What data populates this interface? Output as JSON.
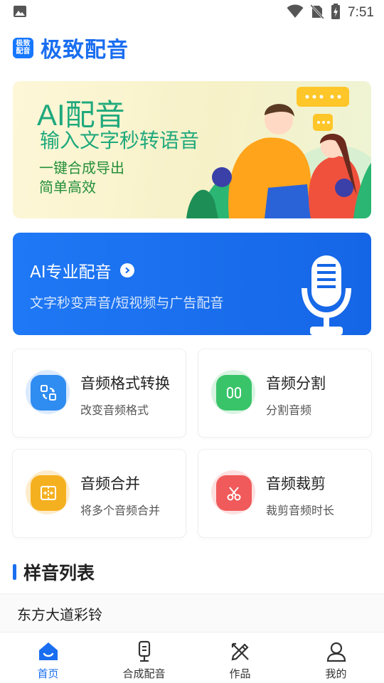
{
  "status_bar": {
    "time": "7:51"
  },
  "header": {
    "logo_text": "极致\n配音",
    "title": "极致配音"
  },
  "banner": {
    "title": "AI配音",
    "subtitle": "输入文字秒转语音",
    "line1": "一键合成导出",
    "line2": "简单高效"
  },
  "pro_card": {
    "title": "AI专业配音",
    "subtitle": "文字秒变声音/短视频与广告配音"
  },
  "tools": [
    {
      "name": "音频格式转换",
      "desc": "改变音频格式",
      "color": "#2f8cf0"
    },
    {
      "name": "音频分割",
      "desc": "分割音频",
      "color": "#39c46a"
    },
    {
      "name": "音频合并",
      "desc": "将多个音频合并",
      "color": "#f5b020"
    },
    {
      "name": "音频裁剪",
      "desc": "裁剪音频时长",
      "color": "#f05a5a"
    }
  ],
  "samples": {
    "title": "样音列表",
    "items": [
      "东方大道彩铃"
    ]
  },
  "nav": {
    "items": [
      {
        "label": "首页",
        "icon": "home-icon",
        "active": true
      },
      {
        "label": "合成配音",
        "icon": "microphone-icon",
        "active": false
      },
      {
        "label": "作品",
        "icon": "works-icon",
        "active": false
      },
      {
        "label": "我的",
        "icon": "profile-icon",
        "active": false
      }
    ]
  },
  "colors": {
    "brand": "#1a6ef0",
    "banner_text": "#1fa97c"
  }
}
